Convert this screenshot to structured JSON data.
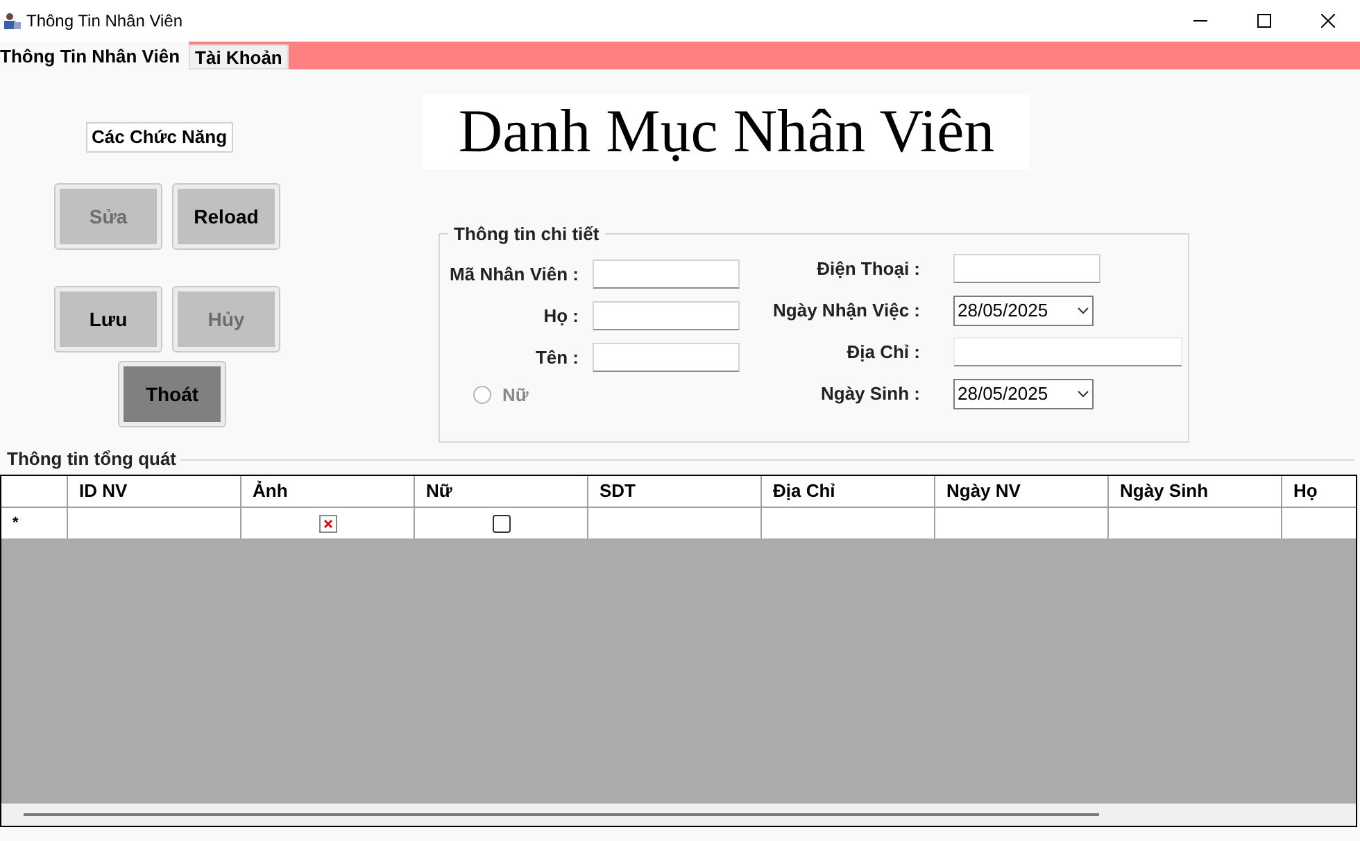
{
  "window": {
    "title": "Thông Tin Nhân Viên"
  },
  "tabs": [
    {
      "label": "Thông Tin Nhân Viên",
      "selected": true
    },
    {
      "label": "Tài Khoản",
      "selected": false
    }
  ],
  "functions": {
    "legend": "Các Chức Năng",
    "buttons": [
      {
        "label": "Sửa",
        "disabled": true,
        "kind": "normal"
      },
      {
        "label": "Reload",
        "disabled": false,
        "kind": "normal"
      },
      {
        "label": "Lưu",
        "disabled": false,
        "kind": "normal"
      },
      {
        "label": "Hủy",
        "disabled": true,
        "kind": "normal"
      },
      {
        "label": "Thoát",
        "disabled": false,
        "kind": "dark"
      }
    ]
  },
  "heading": "Danh Mục Nhân Viên",
  "details": {
    "legend": "Thông tin chi tiết",
    "left_fields": [
      {
        "label": "Mã Nhân Viên :",
        "kind": "text"
      },
      {
        "label": "Họ :",
        "kind": "text"
      },
      {
        "label": "Tên :",
        "kind": "text"
      },
      {
        "label": "Nữ",
        "kind": "radio",
        "checked": false
      }
    ],
    "right_fields": [
      {
        "label": "Điện Thoại :",
        "kind": "text"
      },
      {
        "label": "Ngày Nhận Việc :",
        "kind": "date",
        "value": "28/05/2025"
      },
      {
        "label": "Địa Chỉ :",
        "kind": "line"
      },
      {
        "label": "Ngày Sinh :",
        "kind": "date",
        "value": "28/05/2025"
      }
    ]
  },
  "overview": {
    "legend": "Thông tin tổng quát",
    "columns": [
      "ID NV",
      "Ảnh",
      "Nữ",
      "SDT",
      "Địa Chỉ",
      "Ngày NV",
      "Ngày Sinh",
      "Họ"
    ],
    "new_row": {
      "marker": "*",
      "cells": [
        {
          "kind": "empty"
        },
        {
          "kind": "image"
        },
        {
          "kind": "checkbox",
          "checked": false
        },
        {
          "kind": "empty"
        },
        {
          "kind": "empty"
        },
        {
          "kind": "empty"
        },
        {
          "kind": "empty"
        },
        {
          "kind": "empty"
        }
      ]
    }
  }
}
